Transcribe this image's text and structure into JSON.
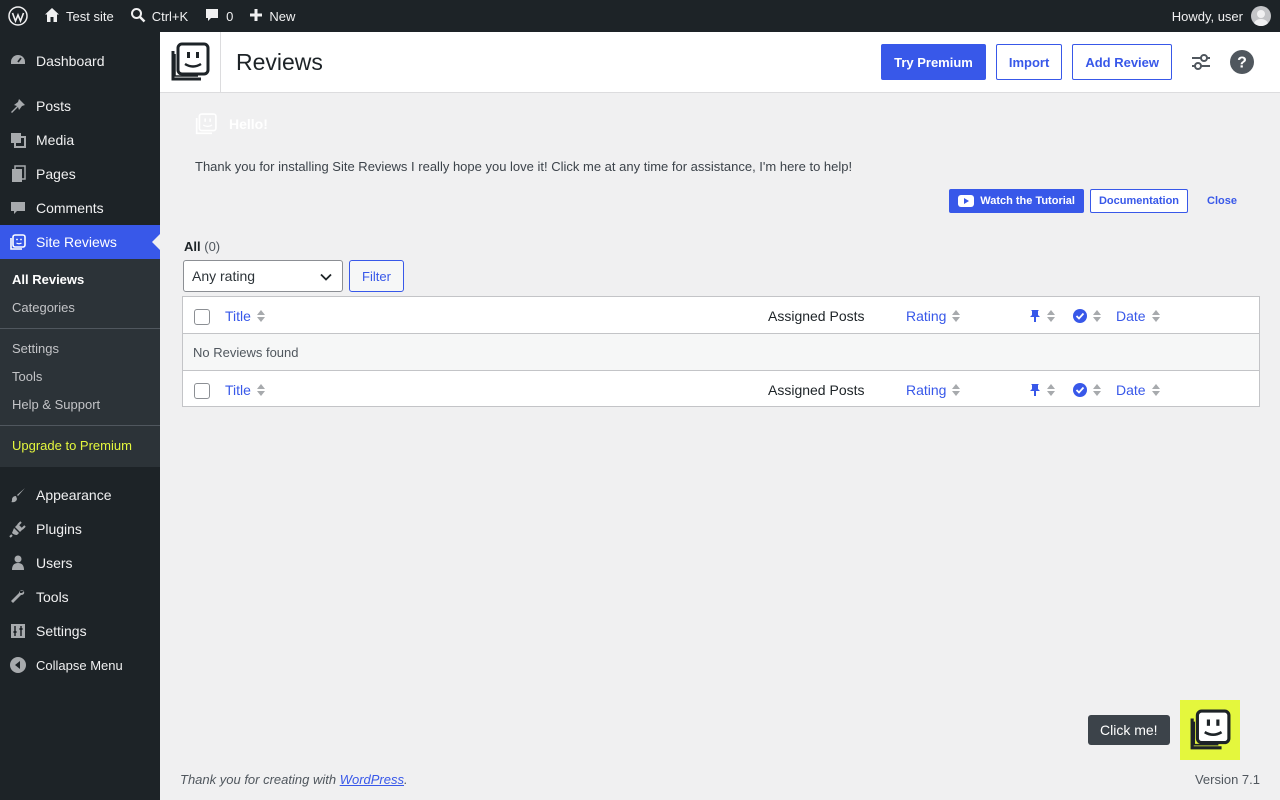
{
  "adminbar": {
    "site_name": "Test site",
    "search_shortcut": "Ctrl+K",
    "comments_count": "0",
    "new_label": "New",
    "howdy": "Howdy, user"
  },
  "sidebar": {
    "items_top": [
      {
        "label": "Dashboard",
        "icon": "dashboard-icon"
      },
      {
        "label": "Posts",
        "icon": "pin-icon"
      },
      {
        "label": "Media",
        "icon": "media-icon"
      },
      {
        "label": "Pages",
        "icon": "pages-icon"
      },
      {
        "label": "Comments",
        "icon": "comment-icon"
      },
      {
        "label": "Site Reviews",
        "icon": "site-reviews-icon"
      }
    ],
    "submenu": {
      "all_reviews": "All Reviews",
      "categories": "Categories",
      "settings": "Settings",
      "tools": "Tools",
      "help": "Help & Support",
      "premium": "Upgrade to Premium"
    },
    "items_bottom": [
      {
        "label": "Appearance",
        "icon": "brush-icon"
      },
      {
        "label": "Plugins",
        "icon": "plugin-icon"
      },
      {
        "label": "Users",
        "icon": "users-icon"
      },
      {
        "label": "Tools",
        "icon": "wrench-icon"
      },
      {
        "label": "Settings",
        "icon": "settings-icon"
      },
      {
        "label": "Collapse Menu",
        "icon": "collapse-icon"
      }
    ]
  },
  "header": {
    "title": "Reviews",
    "try_premium": "Try Premium",
    "import": "Import",
    "add_review": "Add Review"
  },
  "notice": {
    "title": "Hello!",
    "text": "Thank you for installing Site Reviews I really hope you love it! Click me at any time for assistance, I'm here to help!",
    "watch": "Watch the Tutorial",
    "documentation": "Documentation",
    "close": "Close"
  },
  "filters": {
    "view_all": "All",
    "view_all_count": "(0)",
    "rating_select": "Any rating",
    "filter_button": "Filter"
  },
  "table": {
    "columns": {
      "title": "Title",
      "assigned_posts": "Assigned Posts",
      "rating": "Rating",
      "date": "Date"
    },
    "empty": "No Reviews found"
  },
  "footer": {
    "thanks_prefix": "Thank you for creating with ",
    "thanks_link": "WordPress",
    "thanks_suffix": ".",
    "version": "Version 7.1"
  },
  "assistant": {
    "click_me": "Click me!"
  },
  "colors": {
    "accent": "#3858e9",
    "adminbar": "#1d2327",
    "premium": "#e4f73d"
  }
}
